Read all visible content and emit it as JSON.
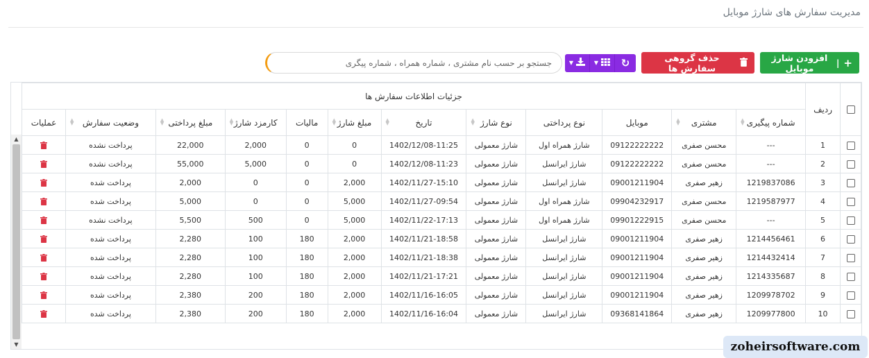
{
  "page": {
    "title": "مدیریت سفارش های شارژ موبایل"
  },
  "toolbar": {
    "add_label": "افزودن شارژ موبایل",
    "add_icon": "plus-icon",
    "group_delete_label": "حذف گروهی سفارش ها",
    "group_delete_icon": "trash-icon",
    "refresh_icon": "refresh-icon",
    "columns_icon": "grid-icon",
    "download_icon": "download-icon"
  },
  "search": {
    "placeholder": "جستجو بر حسب نام مشتری ، شماره همراه ، شماره پیگری",
    "value": ""
  },
  "table": {
    "row_num_header": "ردیف",
    "group_header": "جزئیات اطلاعات سفارش ها",
    "columns": {
      "tracking": "شماره پیگیری",
      "customer": "مشتری",
      "mobile": "موبایل",
      "payment_type": "نوع پرداختی",
      "charge_type": "نوع شارژ",
      "date": "تاریخ",
      "charge_amount": "مبلغ شارژ",
      "tax": "مالیات",
      "fee": "کارمزد شارژ",
      "payment_amount": "مبلغ پرداختی",
      "status": "وضعیت سفارش",
      "actions": "عملیات"
    },
    "rows": [
      {
        "num": "1",
        "tracking": "---",
        "customer": "محسن صفری",
        "mobile": "09122222222",
        "payment_type": "شارژ همراه اول",
        "charge_type": "شارژ معمولی",
        "date": "1402/12/08-11:25",
        "charge_amount": "0",
        "tax": "0",
        "fee": "2,000",
        "payment_amount": "22,000",
        "status": "پرداخت نشده",
        "paid": false
      },
      {
        "num": "2",
        "tracking": "---",
        "customer": "محسن صفری",
        "mobile": "09122222222",
        "payment_type": "شارژ ایرانسل",
        "charge_type": "شارژ معمولی",
        "date": "1402/12/08-11:23",
        "charge_amount": "0",
        "tax": "0",
        "fee": "5,000",
        "payment_amount": "55,000",
        "status": "پرداخت نشده",
        "paid": false
      },
      {
        "num": "3",
        "tracking": "1219837086",
        "customer": "زهیر صفری",
        "mobile": "09001211904",
        "payment_type": "شارژ ایرانسل",
        "charge_type": "شارژ معمولی",
        "date": "1402/11/27-15:10",
        "charge_amount": "2,000",
        "tax": "0",
        "fee": "0",
        "payment_amount": "2,000",
        "status": "پرداخت شده",
        "paid": true
      },
      {
        "num": "4",
        "tracking": "1219587977",
        "customer": "محسن صفری",
        "mobile": "09904232917",
        "payment_type": "شارژ همراه اول",
        "charge_type": "شارژ معمولی",
        "date": "1402/11/27-09:54",
        "charge_amount": "5,000",
        "tax": "0",
        "fee": "0",
        "payment_amount": "5,000",
        "status": "پرداخت شده",
        "paid": true
      },
      {
        "num": "5",
        "tracking": "---",
        "customer": "محسن صفری",
        "mobile": "09901222915",
        "payment_type": "شارژ همراه اول",
        "charge_type": "شارژ معمولی",
        "date": "1402/11/22-17:13",
        "charge_amount": "5,000",
        "tax": "0",
        "fee": "500",
        "payment_amount": "5,500",
        "status": "پرداخت نشده",
        "paid": false
      },
      {
        "num": "6",
        "tracking": "1214456461",
        "customer": "زهیر صفری",
        "mobile": "09001211904",
        "payment_type": "شارژ ایرانسل",
        "charge_type": "شارژ معمولی",
        "date": "1402/11/21-18:58",
        "charge_amount": "2,000",
        "tax": "180",
        "fee": "100",
        "payment_amount": "2,280",
        "status": "پرداخت شده",
        "paid": true
      },
      {
        "num": "7",
        "tracking": "1214432414",
        "customer": "زهیر صفری",
        "mobile": "09001211904",
        "payment_type": "شارژ ایرانسل",
        "charge_type": "شارژ معمولی",
        "date": "1402/11/21-18:38",
        "charge_amount": "2,000",
        "tax": "180",
        "fee": "100",
        "payment_amount": "2,280",
        "status": "پرداخت شده",
        "paid": true
      },
      {
        "num": "8",
        "tracking": "1214335687",
        "customer": "زهیر صفری",
        "mobile": "09001211904",
        "payment_type": "شارژ ایرانسل",
        "charge_type": "شارژ معمولی",
        "date": "1402/11/21-17:21",
        "charge_amount": "2,000",
        "tax": "180",
        "fee": "100",
        "payment_amount": "2,280",
        "status": "پرداخت شده",
        "paid": true
      },
      {
        "num": "9",
        "tracking": "1209978702",
        "customer": "زهیر صفری",
        "mobile": "09001211904",
        "payment_type": "شارژ ایرانسل",
        "charge_type": "شارژ معمولی",
        "date": "1402/11/16-16:05",
        "charge_amount": "2,000",
        "tax": "180",
        "fee": "200",
        "payment_amount": "2,380",
        "status": "پرداخت شده",
        "paid": true
      },
      {
        "num": "10",
        "tracking": "1209977800",
        "customer": "زهیر صفری",
        "mobile": "09368141864",
        "payment_type": "شارژ ایرانسل",
        "charge_type": "شارژ معمولی",
        "date": "1402/11/16-16:04",
        "charge_amount": "2,000",
        "tax": "180",
        "fee": "200",
        "payment_amount": "2,380",
        "status": "پرداخت شده",
        "paid": true
      }
    ]
  },
  "watermark": {
    "text": "zoheirsoftware.com"
  },
  "colors": {
    "add_button": "#28a745",
    "delete_button": "#dc3545",
    "purple_buttons": "#8a2be2",
    "unpaid": "#e53935",
    "paid": "#2e7d32"
  }
}
